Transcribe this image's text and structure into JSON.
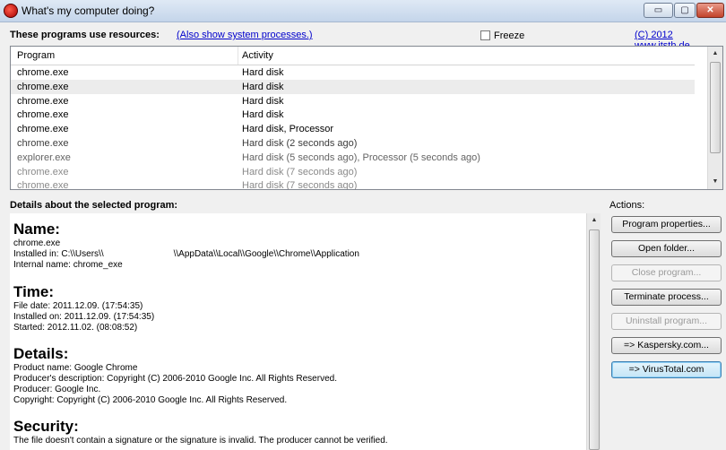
{
  "window": {
    "title": "What's my computer doing?",
    "minimize": "▭",
    "maximize": "▢",
    "close": "✕"
  },
  "header": {
    "programs_label": "These programs use resources:",
    "system_link": "(Also show system processes.)",
    "freeze_label": "Freeze",
    "copyright_link": "(C) 2012 www.itsth.de"
  },
  "table": {
    "columns": [
      "Program",
      "Activity"
    ],
    "rows": [
      {
        "program": "chrome.exe",
        "activity": "Hard disk",
        "color": "#000000"
      },
      {
        "program": "chrome.exe",
        "activity": "Hard disk",
        "color": "#000000"
      },
      {
        "program": "chrome.exe",
        "activity": "Hard disk",
        "color": "#000000"
      },
      {
        "program": "chrome.exe",
        "activity": "Hard disk",
        "color": "#000000"
      },
      {
        "program": "chrome.exe",
        "activity": "Hard disk, Processor",
        "color": "#000000"
      },
      {
        "program": "chrome.exe",
        "activity": "Hard disk (2 seconds ago)",
        "color": "#3c3c3c"
      },
      {
        "program": "explorer.exe",
        "activity": "Hard disk (5 seconds ago), Processor (5 seconds ago)",
        "color": "#646464"
      },
      {
        "program": "chrome.exe",
        "activity": "Hard disk (7 seconds ago)",
        "color": "#8a8a8a"
      },
      {
        "program": "chrome.exe",
        "activity": "Hard disk (7 seconds ago)",
        "color": "#8a8a8a"
      }
    ]
  },
  "details": {
    "section_label": "Details about the selected program:",
    "name_heading": "Name:",
    "name_value": "chrome.exe",
    "installed_prefix": "Installed in: C:\\\\Users\\\\",
    "installed_suffix": "\\\\AppData\\\\Local\\\\Google\\\\Chrome\\\\Application",
    "internal_name": "Internal name: chrome_exe",
    "time_heading": "Time:",
    "file_date": "File date: 2011.12.09. (17:54:35)",
    "installed_on": "Installed on: 2011.12.09. (17:54:35)",
    "started": "Started: 2012.11.02. (08:08:52)",
    "details_heading": "Details:",
    "product_name": "Product name: Google Chrome",
    "producer_description": "Producer's description: Copyright (C) 2006-2010 Google Inc. All Rights Reserved.",
    "producer": "Producer: Google Inc.",
    "copyright": "Copyright: Copyright (C) 2006-2010 Google Inc. All Rights Reserved.",
    "security_heading": "Security:",
    "security_text": "The file doesn't contain a signature or the signature is invalid. The producer cannot be verified."
  },
  "actions": {
    "label": "Actions:",
    "program_properties": "Program properties...",
    "open_folder": "Open folder...",
    "close_program": "Close program...",
    "terminate_process": "Terminate process...",
    "uninstall_program": "Uninstall program...",
    "kaspersky": "=> Kaspersky.com...",
    "virustotal": "=> VirusTotal.com"
  }
}
